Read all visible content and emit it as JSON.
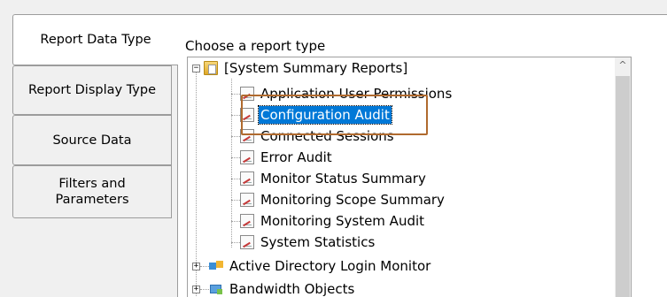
{
  "tabs": [
    {
      "label": "Report Data Type",
      "active": true
    },
    {
      "label": "Report Display Type",
      "active": false
    },
    {
      "label": "Source Data",
      "active": false
    },
    {
      "label": "Filters and Parameters",
      "active": false
    }
  ],
  "main": {
    "choose_label": "Choose a report type"
  },
  "tree": {
    "root": {
      "label": "[System Summary Reports]",
      "expanded": true,
      "icon": "folder-icon"
    },
    "children": [
      {
        "label": "Application User Permissions",
        "icon": "report-icon"
      },
      {
        "label": "Configuration Audit",
        "icon": "report-icon",
        "selected": true
      },
      {
        "label": "Connected Sessions",
        "icon": "report-icon"
      },
      {
        "label": "Error Audit",
        "icon": "report-icon"
      },
      {
        "label": "Monitor Status Summary",
        "icon": "report-icon"
      },
      {
        "label": "Monitoring Scope Summary",
        "icon": "report-icon"
      },
      {
        "label": "Monitoring System Audit",
        "icon": "report-icon"
      },
      {
        "label": "System Statistics",
        "icon": "report-icon"
      }
    ],
    "collapsed_groups": [
      {
        "label": "Active Directory Login Monitor",
        "icon": "active-directory-icon"
      },
      {
        "label": "Bandwidth Objects",
        "icon": "bandwidth-icon"
      }
    ]
  },
  "colors": {
    "selection": "#0078d7",
    "highlight_box": "#b06a2e"
  }
}
